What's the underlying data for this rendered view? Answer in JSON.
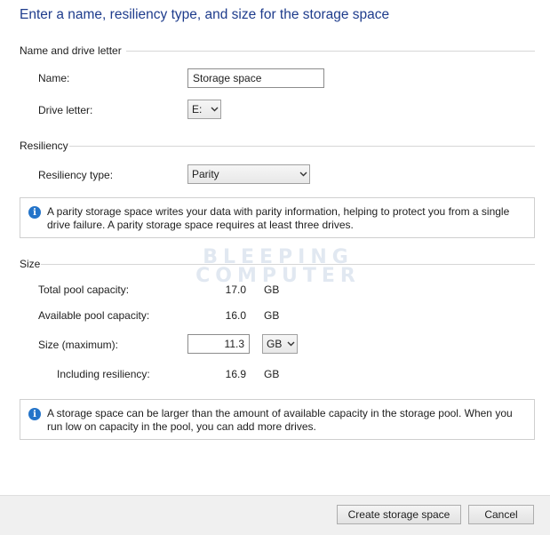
{
  "title": "Enter a name, resiliency type, and size for the storage space",
  "name_section": {
    "heading": "Name and drive letter",
    "name_label": "Name:",
    "name_value": "Storage space",
    "drive_label": "Drive letter:",
    "drive_value": "E:"
  },
  "resiliency_section": {
    "heading": "Resiliency",
    "type_label": "Resiliency type:",
    "type_value": "Parity",
    "info_text": "A parity storage space writes your data with parity information, helping to protect you from a single drive failure. A parity storage space requires at least three drives."
  },
  "size_section": {
    "heading": "Size",
    "total_label": "Total pool capacity:",
    "total_value": "17.0",
    "total_unit": "GB",
    "available_label": "Available pool capacity:",
    "available_value": "16.0",
    "available_unit": "GB",
    "size_label": "Size (maximum):",
    "size_value": "11.3",
    "size_unit": "GB",
    "including_label": "Including resiliency:",
    "including_value": "16.9",
    "including_unit": "GB",
    "info_text": "A storage space can be larger than the amount of available capacity in the storage pool. When you run low on capacity in the pool, you can add more drives."
  },
  "watermark": [
    "BLEEPING",
    "COMPUTER"
  ],
  "buttons": {
    "create": "Create storage space",
    "cancel": "Cancel"
  },
  "icons": {
    "info": "info-icon",
    "dropdown": "chevron-down-icon"
  },
  "colors": {
    "title": "#1e3c8c",
    "info_icon": "#2474c9",
    "footer_bg": "#f0f0f0"
  }
}
